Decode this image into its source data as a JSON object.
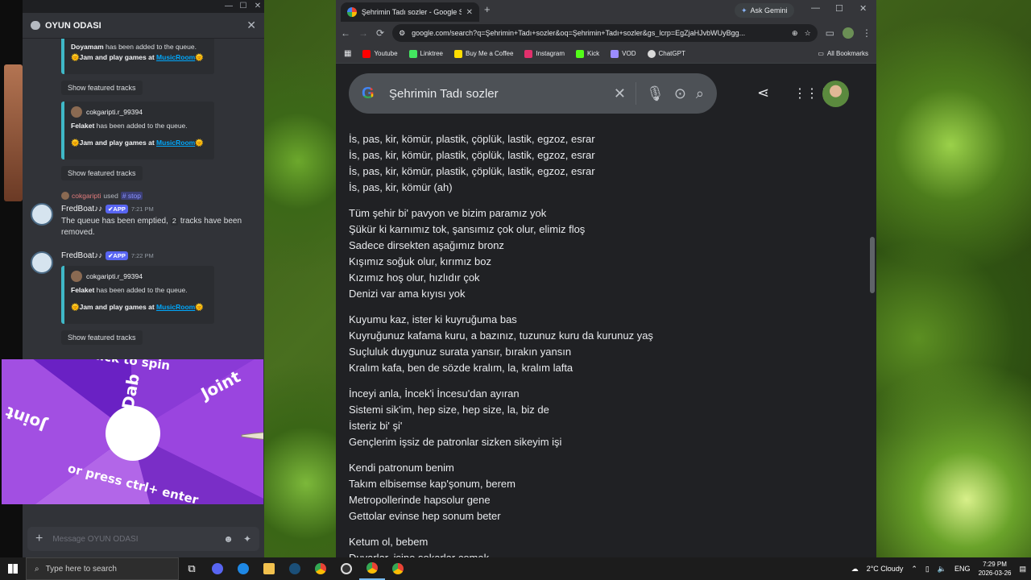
{
  "discord": {
    "title": "OYUN ODASI",
    "embeds": [
      {
        "added_name": "Doyamam",
        "added_text": "has been added to the queue.",
        "jam_prefix": "Jam and play games at",
        "jam_link": "MusicRoom"
      },
      {
        "user": "cokgaripti.r_99394",
        "added_name": "Felaket",
        "added_text": "has been added to the queue.",
        "jam_prefix": "Jam and play games at",
        "jam_link": "MusicRoom"
      },
      {
        "user": "cokgaripti.r_99394",
        "added_name": "Felaket",
        "added_text": "has been added to the queue.",
        "jam_prefix": "Jam and play games at",
        "jam_link": "MusicRoom"
      }
    ],
    "featured_btn": "Show featured tracks",
    "used": {
      "user": "cokgaripti",
      "used": "used",
      "cmd": "# stop"
    },
    "bot_name": "FredBoat♪♪",
    "app_tag": "✔APP",
    "msg1_time": "7:21 PM",
    "msg1_text_a": "The queue has been emptied,",
    "msg1_code": "2",
    "msg1_text_b": "tracks have been removed.",
    "msg2_time": "7:22 PM",
    "composer_placeholder": "Message OYUN ODASI"
  },
  "wheel": {
    "labels": [
      "Dab",
      "Joint",
      "Joint",
      "Click to spin",
      "or press ctrl+ enter"
    ]
  },
  "chrome": {
    "tab_title": "Şehrimin Tadı sozler - Google S",
    "ask_gemini": "Ask Gemini",
    "url": "google.com/search?q=Şehrimin+Tadı+sozler&oq=Şehrimin+Tadı+sozler&gs_lcrp=EgZjaHJvbWUyBgg...",
    "bookmarks": [
      {
        "label": "Youtube",
        "color": "#ff0000"
      },
      {
        "label": "Linktree",
        "color": "#43e660"
      },
      {
        "label": "Buy Me a Coffee",
        "color": "#ffdd00"
      },
      {
        "label": "Instagram",
        "color": "#e1306c"
      },
      {
        "label": "Kick",
        "color": "#53fc18"
      },
      {
        "label": "VOD",
        "color": "#9b8cff"
      },
      {
        "label": "ChatGPT",
        "color": "#d9d9d9"
      }
    ],
    "all_bookmarks": "All Bookmarks",
    "query": "Şehrimin Tadı sozler"
  },
  "lyrics": [
    [
      "İs, pas, kir, kömür, plastik, çöplük, lastik, egzoz, esrar",
      "İs, pas, kir, kömür, plastik, çöplük, lastik, egzoz, esrar",
      "İs, pas, kir, kömür, plastik, çöplük, lastik, egzoz, esrar",
      "İs, pas, kir, kömür (ah)"
    ],
    [
      "Tüm şehir bi' pavyon ve bizim paramız yok",
      "Şükür ki karnımız tok, şansımız çok olur, elimiz floş",
      "Sadece dirsekten aşağımız bronz",
      "Kışımız soğuk olur, kırımız boz",
      "Kızımız hoş olur, hızlıdır çok",
      "Denizi var ama kıyısı yok"
    ],
    [
      "Kuyumu kaz, ister ki kuyruğuma bas",
      "Kuyruğunuz kafama kuru, a bazınız, tuzunuz kuru da kurunuz yaş",
      "Suçluluk duygunuz surata yansır, bırakın yansın",
      "Kralım kafa, ben de sözde kralım, la, kralım lafta"
    ],
    [
      "İnceyi anla, İncek'i İncesu'dan ayıran",
      "Sistemi sik'im, hep size, hep size, la, biz de",
      "İsteriz bi' şi'",
      "Gençlerim işsiz de patronlar sizken sikeyim işi"
    ],
    [
      "Kendi patronum benim",
      "Takım elbisemse kap'şonum, berem",
      "Metropollerinde hapsolur gene",
      "Gettolar evinse hep sonum beter"
    ],
    [
      "Ketum ol, bebem",
      "Duyarlar, işine sokarlar çomak"
    ]
  ],
  "taskbar": {
    "search": "Type here to search",
    "weather": "2°C  Cloudy",
    "lang": "ENG",
    "time": "7:29 PM",
    "date": "2026-03-26"
  }
}
